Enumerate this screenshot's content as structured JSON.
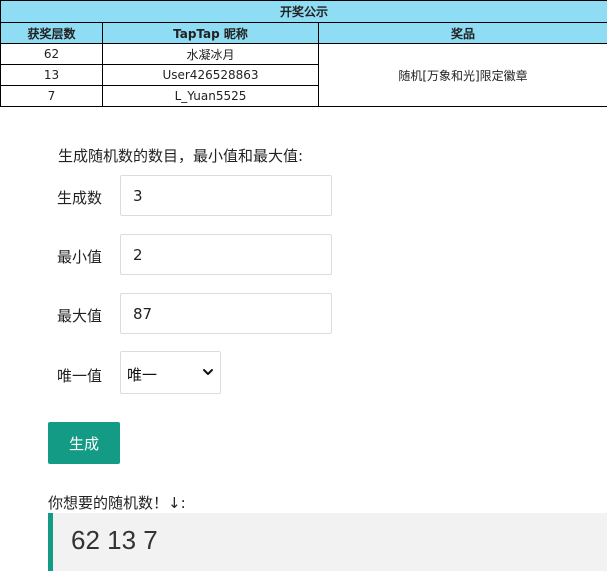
{
  "table": {
    "title": "开奖公示",
    "headers": [
      "获奖层数",
      "TapTap 昵称",
      "奖品"
    ],
    "rows": [
      {
        "floor": "62",
        "nickname": "水凝冰月"
      },
      {
        "floor": "13",
        "nickname": "User426528863"
      },
      {
        "floor": "7",
        "nickname": "L_Yuan5525"
      }
    ],
    "prize": "随机[万象和光]限定徽章",
    "colors": {
      "header_bg": "#8fdcf5"
    }
  },
  "form": {
    "instruction": "生成随机数的数目，最小值和最大值:",
    "count_label": "生成数",
    "count_value": "3",
    "min_label": "最小值",
    "min_value": "2",
    "max_label": "最大值",
    "max_value": "87",
    "unique_label": "唯一值",
    "unique_selected": "唯一",
    "unique_icon": "chevron-down-icon",
    "generate_label": "生成"
  },
  "result": {
    "label": "你想要的随机数！↓:",
    "value": "62 13 7"
  },
  "colors": {
    "accent": "#149b86",
    "result_bg": "#f2f2f2"
  }
}
